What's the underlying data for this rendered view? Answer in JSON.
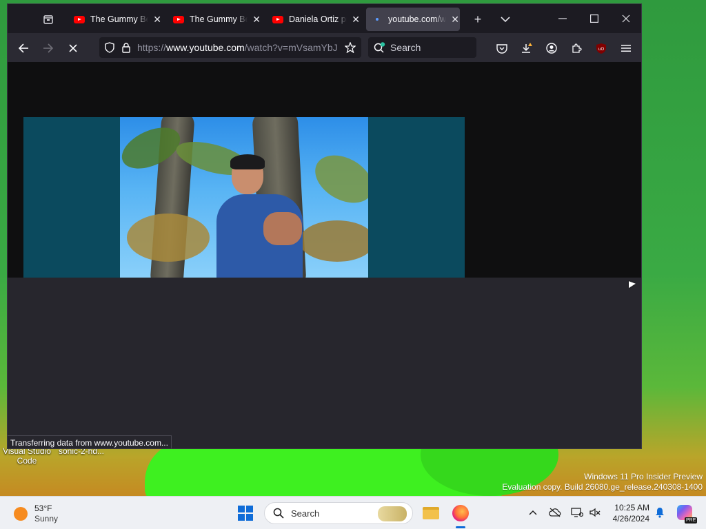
{
  "desktop": {
    "icons": [
      {
        "label": "Visual Studio Code"
      },
      {
        "label": "sonic-2-hd..."
      }
    ],
    "watermark": {
      "line1": "Windows 11 Pro Insider Preview",
      "line2": "Evaluation copy. Build 26080.ge_release.240308-1400"
    }
  },
  "browser": {
    "tabs": [
      {
        "title": "The Gummy Bear Song",
        "favicon": "youtube-icon",
        "active": false
      },
      {
        "title": "The Gummy Bear Song",
        "favicon": "youtube-icon",
        "active": false
      },
      {
        "title": "Daniela Ortiz presenta",
        "favicon": "youtube-icon",
        "active": false
      },
      {
        "title": "youtube.com/watch",
        "favicon": "loading-dot-icon",
        "active": true
      }
    ],
    "new_tab_label": "+",
    "url": {
      "scheme": "https://",
      "host": "www.youtube.com",
      "path": "/watch?v=mVsamYbJ"
    },
    "search_placeholder": "Search",
    "status_text": "Transferring data from www.youtube.com...",
    "colors": {
      "accent": "#ff0000",
      "toolbar": "#2b2a33",
      "tabstrip": "#1c1b22"
    }
  },
  "taskbar": {
    "weather": {
      "temp": "53°F",
      "condition": "Sunny"
    },
    "search_placeholder": "Search",
    "clock": {
      "time": "10:25 AM",
      "date": "4/26/2024"
    },
    "copilot_badge": "PRE"
  }
}
